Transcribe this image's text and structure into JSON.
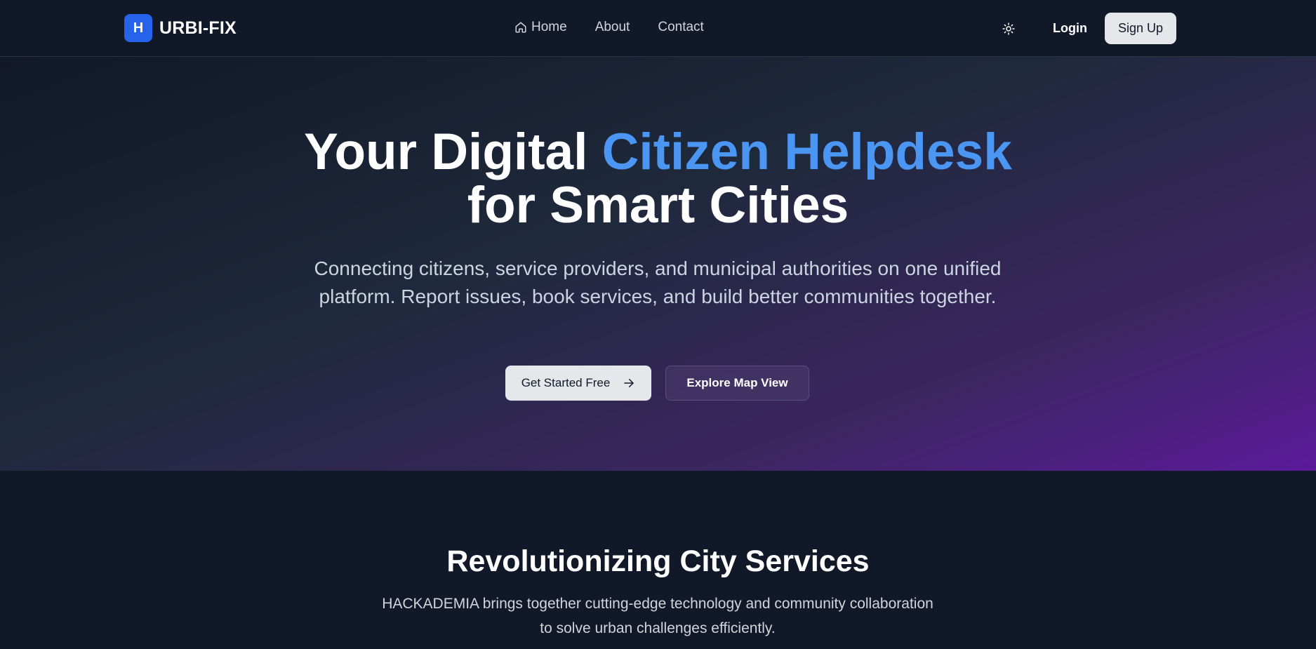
{
  "navbar": {
    "logo_letter": "H",
    "brand_name": "URBI-FIX",
    "links": [
      {
        "label": "Home",
        "icon": "home-icon"
      },
      {
        "label": "About"
      },
      {
        "label": "Contact"
      }
    ],
    "theme_icon": "sun-icon",
    "login_label": "Login",
    "signup_label": "Sign Up"
  },
  "hero": {
    "title_part1": "Your Digital ",
    "title_accent": "Citizen Helpdesk",
    "title_part2": "for Smart Cities",
    "subtitle": "Connecting citizens, service providers, and municipal authorities on one unified platform. Report issues, book services, and build better communities together.",
    "primary_cta": "Get Started Free",
    "primary_cta_icon": "arrow-right-icon",
    "secondary_cta": "Explore Map View"
  },
  "section": {
    "title": "Revolutionizing City Services",
    "subtitle": "HACKADEMIA brings together cutting-edge technology and community collaboration to solve urban challenges efficiently."
  },
  "colors": {
    "accent_blue": "#4b96f2",
    "logo_blue": "#2563eb",
    "background": "#111827",
    "gradient_purple": "#5b1a9a"
  }
}
